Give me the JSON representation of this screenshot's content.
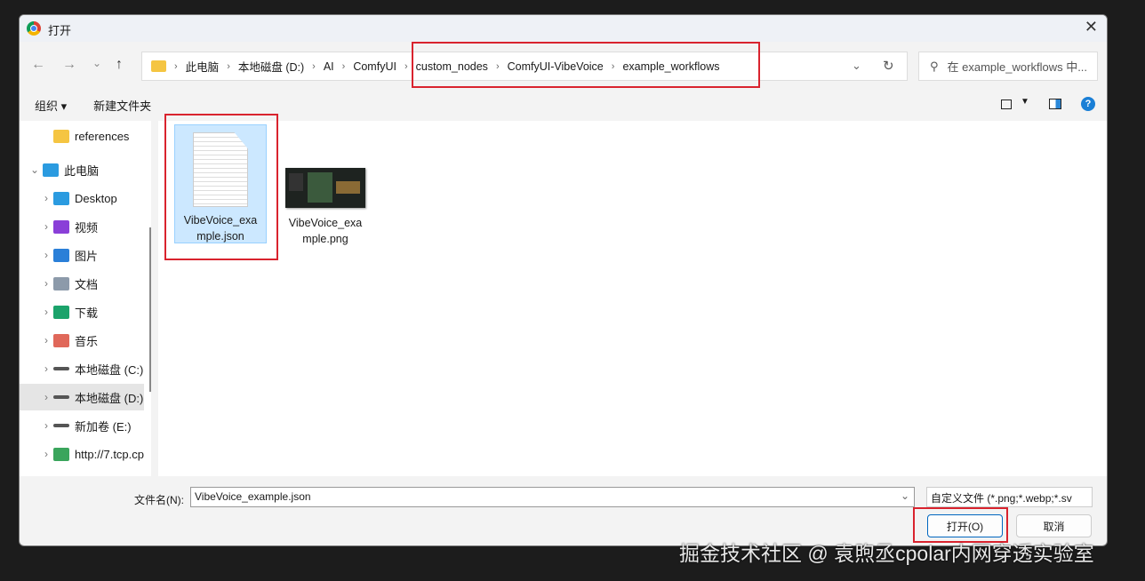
{
  "window": {
    "title": "打开",
    "close_icon": "close-icon",
    "app_icon": "chrome-icon"
  },
  "nav": {
    "back": "←",
    "forward": "→",
    "recent": "⌄",
    "up": "↑"
  },
  "breadcrumb": [
    "此电脑",
    "本地磁盘 (D:)",
    "AI",
    "ComfyUI",
    "custom_nodes",
    "ComfyUI-VibeVoice",
    "example_workflows"
  ],
  "search": {
    "placeholder": "在 example_workflows 中..."
  },
  "toolbar": {
    "organize": "组织 ▾",
    "new_folder": "新建文件夹"
  },
  "sidebar": {
    "items": [
      {
        "label": "references",
        "icon": "folder-icon",
        "color": "#f5c542",
        "level": 1
      },
      {
        "label": "此电脑",
        "icon": "computer-icon",
        "color": "#2b9be0",
        "level": 0,
        "expanded": true
      },
      {
        "label": "Desktop",
        "icon": "desktop-icon",
        "color": "#2b9be0",
        "level": 1
      },
      {
        "label": "视频",
        "icon": "video-icon",
        "color": "#8a3fd8",
        "level": 1
      },
      {
        "label": "图片",
        "icon": "pictures-icon",
        "color": "#2a7fd8",
        "level": 1
      },
      {
        "label": "文档",
        "icon": "documents-icon",
        "color": "#8c9aaa",
        "level": 1
      },
      {
        "label": "下载",
        "icon": "download-icon",
        "color": "#1ba36b",
        "level": 1
      },
      {
        "label": "音乐",
        "icon": "music-icon",
        "color": "#e0685a",
        "level": 1
      },
      {
        "label": "本地磁盘 (C:)",
        "icon": "drive-icon",
        "color": "#555",
        "level": 1
      },
      {
        "label": "本地磁盘 (D:)",
        "icon": "drive-icon",
        "color": "#555",
        "level": 1,
        "selected": true
      },
      {
        "label": "新加卷 (E:)",
        "icon": "drive-icon",
        "color": "#555",
        "level": 1
      },
      {
        "label": "http://7.tcp.cp",
        "icon": "network-icon",
        "color": "#3aa55c",
        "level": 1
      }
    ]
  },
  "files": [
    {
      "name": "VibeVoice_example.json",
      "line1": "VibeVoice_exa",
      "line2": "mple.json",
      "selected": true
    },
    {
      "name": "VibeVoice_example.png",
      "line1": "VibeVoice_exa",
      "line2": "mple.png",
      "selected": false
    }
  ],
  "bottom": {
    "filename_label": "文件名(N):",
    "filename_value": "VibeVoice_example.json",
    "filter": "自定义文件 (*.png;*.webp;*.sv",
    "open": "打开(O)",
    "cancel": "取消"
  },
  "watermark": "掘金技术社区 @ 袁煦丞cpolar内网穿透实验室",
  "colors": {
    "annotation": "#d9232e",
    "selection": "#cce8ff",
    "accent": "#0067c0"
  }
}
